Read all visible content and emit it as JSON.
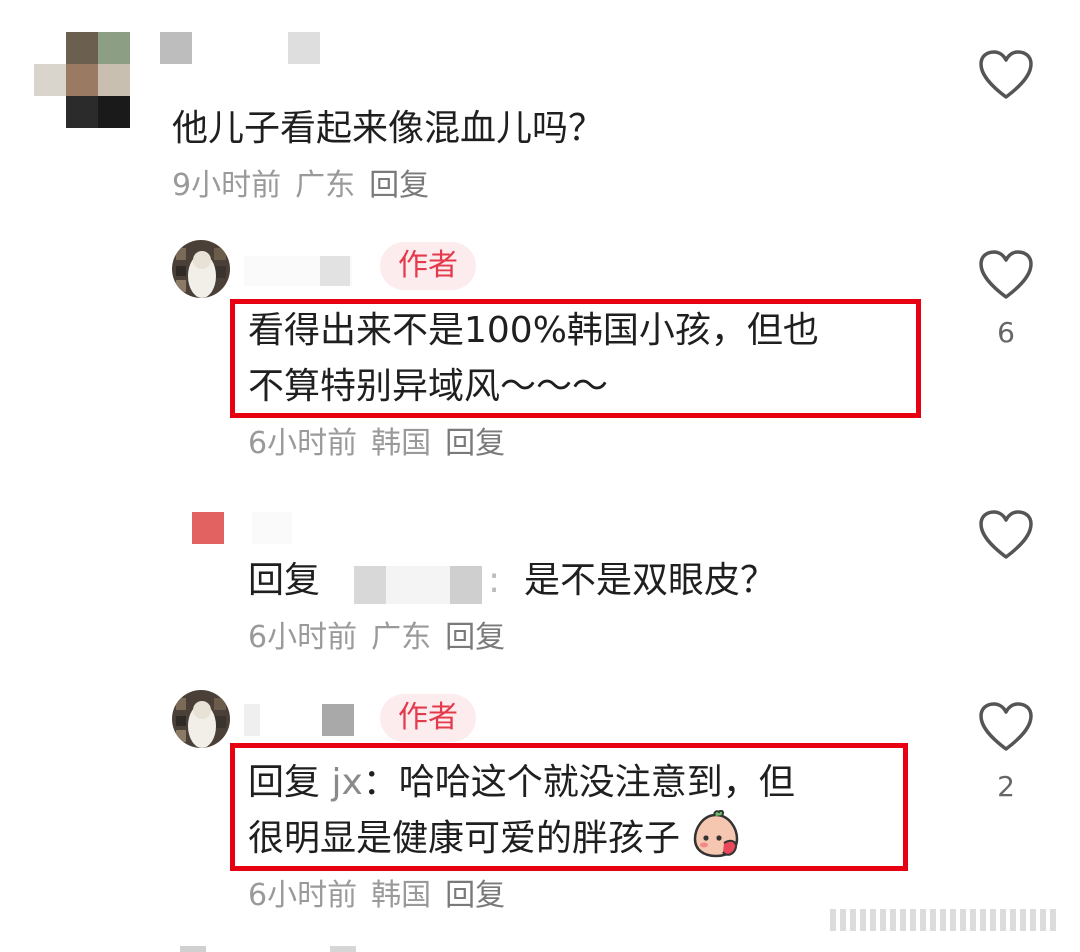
{
  "comments": [
    {
      "text": "他儿子看起来像混血儿吗？",
      "time": "9小时前",
      "location": "广东",
      "reply_label": "回复"
    },
    {
      "author_badge": "作者",
      "text_line1": "看得出来不是100%韩国小孩，但也",
      "text_line2": "不算特别异域风～～～",
      "time": "6小时前",
      "location": "韩国",
      "reply_label": "回复",
      "likes": "6"
    },
    {
      "reply_prefix": "回复",
      "separator": ":",
      "text": "是不是双眼皮？",
      "time": "6小时前",
      "location": "广东",
      "reply_label": "回复"
    },
    {
      "author_badge": "作者",
      "reply_prefix": "回复",
      "reply_target": "jx",
      "text_line1_rest": "：哈哈这个就没注意到，但",
      "text_line2": "很明显是健康可爱的胖孩子",
      "time": "6小时前",
      "location": "韩国",
      "reply_label": "回复",
      "likes": "2"
    }
  ],
  "colors": {
    "highlight_box": "#e60012",
    "author_badge_bg": "#fdecee",
    "author_badge_text": "#e33a4c",
    "meta_text": "#9a9a9a"
  },
  "icons": [
    "heart-outline-icon",
    "blush-emoji-icon"
  ]
}
